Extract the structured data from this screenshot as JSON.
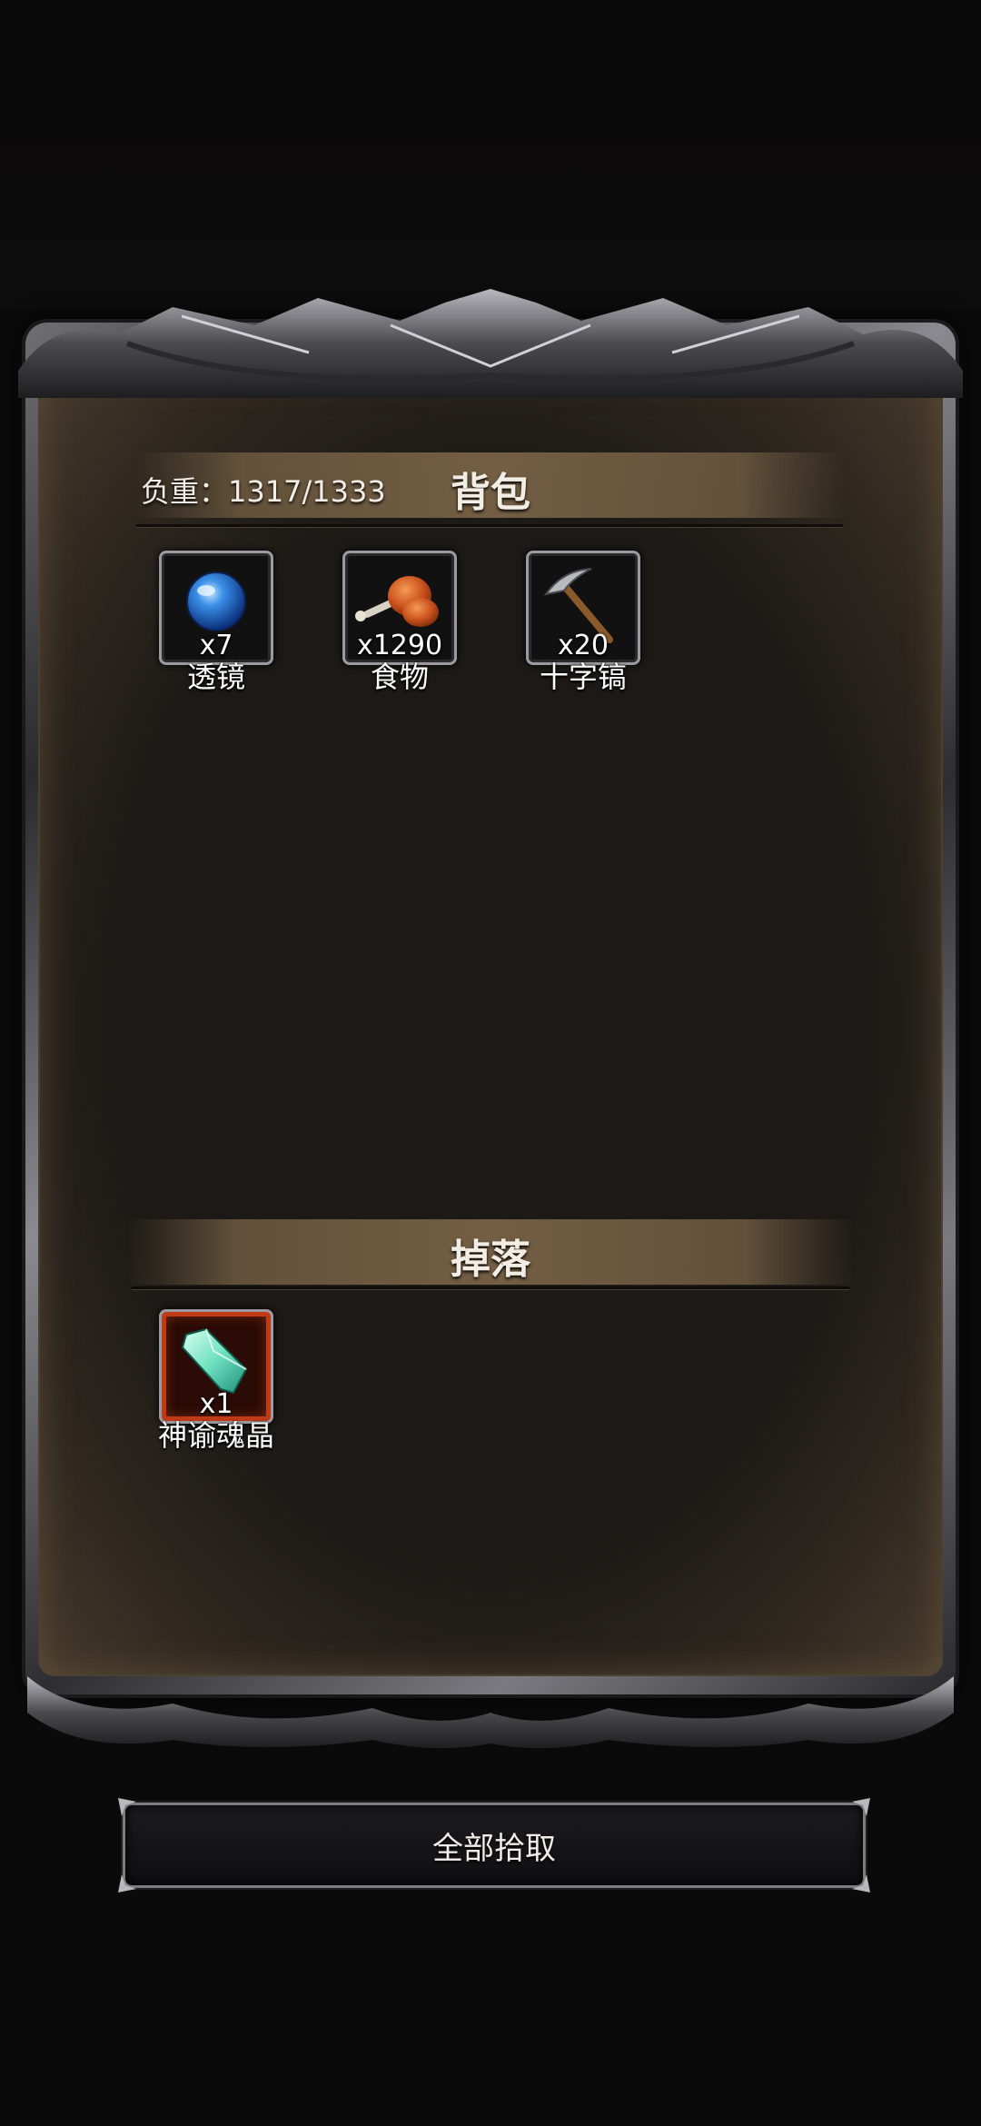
{
  "backpack": {
    "title": "背包",
    "weight_label": "负重：1317/1333",
    "items": [
      {
        "name": "透镜",
        "qty": "x7",
        "icon": "lens-icon"
      },
      {
        "name": "食物",
        "qty": "x1290",
        "icon": "food-icon"
      },
      {
        "name": "十字镐",
        "qty": "x20",
        "icon": "pickaxe-icon"
      }
    ]
  },
  "drops": {
    "title": "掉落",
    "items": [
      {
        "name": "神谕魂晶",
        "qty": "x1",
        "icon": "crystal-icon"
      }
    ]
  },
  "actions": {
    "pickup_all_label": "全部拾取"
  }
}
